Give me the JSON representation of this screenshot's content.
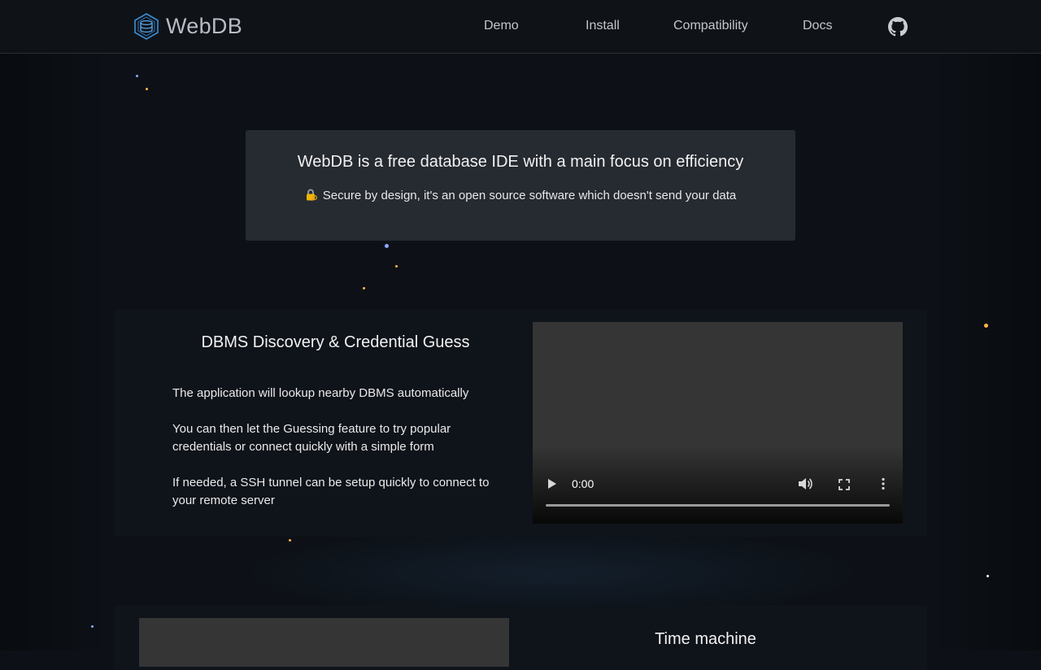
{
  "header": {
    "brand": "WebDB",
    "nav": [
      "Demo",
      "Install",
      "Compatibility",
      "Docs"
    ],
    "github_icon": "github-icon"
  },
  "hero": {
    "title": "WebDB is a free database IDE with a main focus on efficiency",
    "subtitle": "Secure by design, it's an open source software which doesn't send your data",
    "subtitle_icon": "lock-with-key-icon"
  },
  "feature_discovery": {
    "title": "DBMS Discovery & Credential Guess",
    "paragraphs": [
      "The application will lookup nearby DBMS automatically",
      "You can then let the Guessing feature to try popular credentials or connect quickly with a simple form",
      "If needed, a SSH tunnel can be setup quickly to connect to your remote server"
    ],
    "video": {
      "time": "0:00",
      "progress": 0
    }
  },
  "feature_time_machine": {
    "title": "Time machine"
  },
  "colors": {
    "background": "#0d1117",
    "accent": "#3a8fd6",
    "panel": "#262a31"
  }
}
